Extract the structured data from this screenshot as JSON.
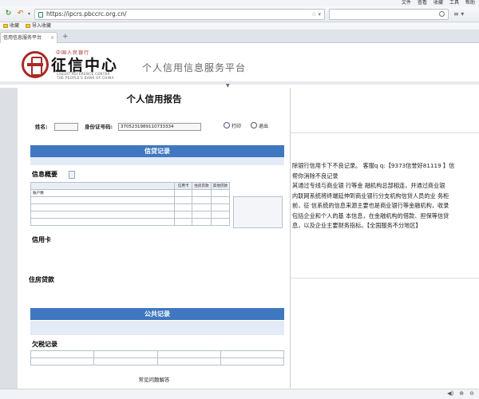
{
  "browser": {
    "menus": [
      "文件",
      "查看",
      "收藏",
      "工具",
      "帮助"
    ],
    "url": "https://ipcrs.pbccrc.org.cn/",
    "address_hint": "",
    "search_placeholder": "",
    "favorites": [
      "收藏",
      "导入收藏"
    ],
    "tab_title": "信用信息服务平台"
  },
  "header": {
    "logo_top": "中国人民银行",
    "logo_main": "征信中心",
    "logo_sub1": "CREDIT REFERENCE CENTER",
    "logo_sub2": "THE PEOPLE'S BANK OF CHINA",
    "platform_title": "个人信用信息服务平台",
    "fold_marker": "▼"
  },
  "report": {
    "title": "个人信用报告",
    "name_label": "姓名:",
    "name_value": "",
    "id_label": "身份证号码:",
    "id_value": "3705231989110733334",
    "print_label": "打印",
    "exit_label": "退出",
    "credit_section_title": "信贷记录",
    "credit_section_note": "",
    "overview_heading": "信息概要",
    "overview_tag": "",
    "summary_headers": [
      "",
      "信用卡",
      "住房贷款",
      "其他贷款"
    ],
    "summary_rows": [
      {
        "label": "账户数",
        "v1": "",
        "v2": "",
        "v3": ""
      },
      {
        "label": "",
        "v1": "",
        "v2": "",
        "v3": ""
      },
      {
        "label": "",
        "v1": "",
        "v2": "",
        "v3": ""
      },
      {
        "label": "",
        "v1": "",
        "v2": "",
        "v3": ""
      },
      {
        "label": "",
        "v1": "",
        "v2": "",
        "v3": ""
      }
    ],
    "side_note": "",
    "credit_card_heading": "信用卡",
    "credit_card_line": "",
    "credit_card_detail": "",
    "housing_heading": "住房贷款",
    "housing_line": "",
    "housing_detail": "",
    "public_section_title": "公共记录",
    "public_section_note": "",
    "tax_heading": "欠税记录",
    "tax_rows": [
      [
        "",
        "",
        "",
        ""
      ],
      [
        "",
        "",
        "",
        ""
      ]
    ],
    "faq": "常见问题解答"
  },
  "right_panel": {
    "lines": [
      "除银行信用卡下不良记录。 客服q q:【9373信誉好81119 】信",
      "帮你消除不良记录",
      "    其通过专线与商业银 行等金 融机构总部相连，并通过商业银",
      "内联网系统将终端延伸到商业银行分支机构信贷人员的业 务柜",
      "前，征 信系统的信息来源主要也是商业银行等金融机构，收录",
      "包括企业和个人的基 本信息，在金融机构的借款、担保等信贷",
      "息，以及企业主要财务指标。【全国服务不分地区】"
    ]
  },
  "status": {
    "icons": [
      "◀)",
      "⊕",
      "⊖"
    ]
  }
}
